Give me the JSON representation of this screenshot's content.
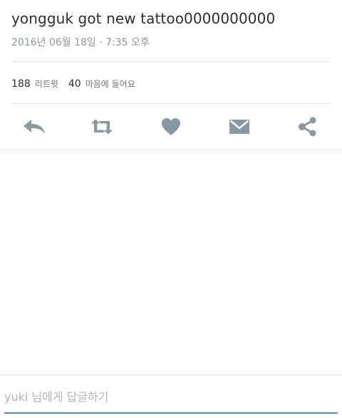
{
  "tweet": {
    "text": "yongguk got new tattoo0000000000",
    "timestamp": "2016년 06월 18일 · 7:35 오후"
  },
  "stats": {
    "retweets_count": "188",
    "retweets_label": "리트윗",
    "likes_count": "40",
    "likes_label": "마음에 들어요"
  },
  "actions": [
    {
      "name": "reply",
      "icon": "reply-icon"
    },
    {
      "name": "retweet",
      "icon": "retweet-icon"
    },
    {
      "name": "like",
      "icon": "heart-icon"
    },
    {
      "name": "direct-message",
      "icon": "envelope-icon"
    },
    {
      "name": "share",
      "icon": "share-icon"
    }
  ],
  "reply": {
    "placeholder": "yuki 님에게 답글하기"
  },
  "colors": {
    "icon": "#8899a6",
    "text": "#292f33",
    "muted": "#8899a6",
    "divider": "#e1e8ed",
    "accent": "#4e8fb6"
  }
}
